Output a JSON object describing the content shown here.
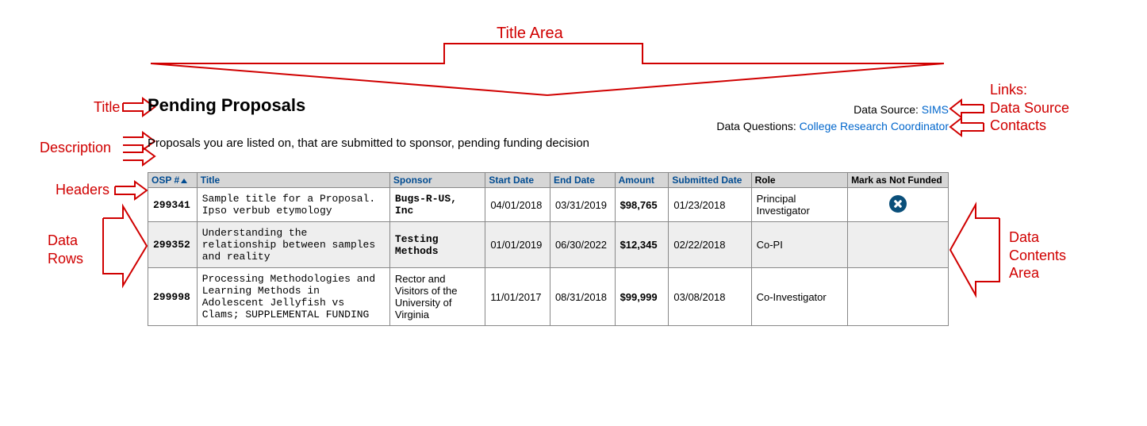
{
  "annotations": {
    "title_area": "Title Area",
    "title": "Title",
    "description": "Description",
    "headers": "Headers",
    "data_rows": "Data\nRows",
    "links": "Links:\nData Source\nContacts",
    "data_contents_area": "Data\nContents\nArea"
  },
  "header": {
    "title": "Pending Proposals",
    "description": "Proposals you are listed on, that are submitted to sponsor, pending funding decision",
    "data_source_label": "Data Source: ",
    "data_source_link": "SIMS",
    "data_questions_label": "Data Questions: ",
    "data_questions_link": "College Research Coordinator"
  },
  "table": {
    "columns": {
      "osp": "OSP #",
      "title": "Title",
      "sponsor": "Sponsor",
      "start": "Start Date",
      "end": "End Date",
      "amount": "Amount",
      "submitted": "Submitted Date",
      "role": "Role",
      "mark": "Mark as Not Funded"
    },
    "rows": [
      {
        "osp": "299341",
        "title": "Sample title for a Proposal. Ipso verbub etymology",
        "sponsor": "Bugs-R-US, Inc",
        "sponsor_style": "mono",
        "start": "04/01/2018",
        "end": "03/31/2019",
        "amount": "$98,765",
        "submitted": "01/23/2018",
        "role": "Principal Investigator",
        "mark": true
      },
      {
        "osp": "299352",
        "title": "Understanding the relationship between samples and reality",
        "sponsor": "Testing Methods",
        "sponsor_style": "mono",
        "start": "01/01/2019",
        "end": "06/30/2022",
        "amount": "$12,345",
        "submitted": "02/22/2018",
        "role": "Co-PI",
        "mark": false
      },
      {
        "osp": "299998",
        "title": "Processing Methodologies and Learning Methods in Adolescent Jellyfish vs Clams; SUPPLEMENTAL FUNDING",
        "sponsor": "Rector and Visitors of the University of Virginia",
        "sponsor_style": "small",
        "start": "11/01/2017",
        "end": "08/31/2018",
        "amount": "$99,999",
        "submitted": "03/08/2018",
        "role": "Co-Investigator",
        "mark": false
      }
    ]
  }
}
